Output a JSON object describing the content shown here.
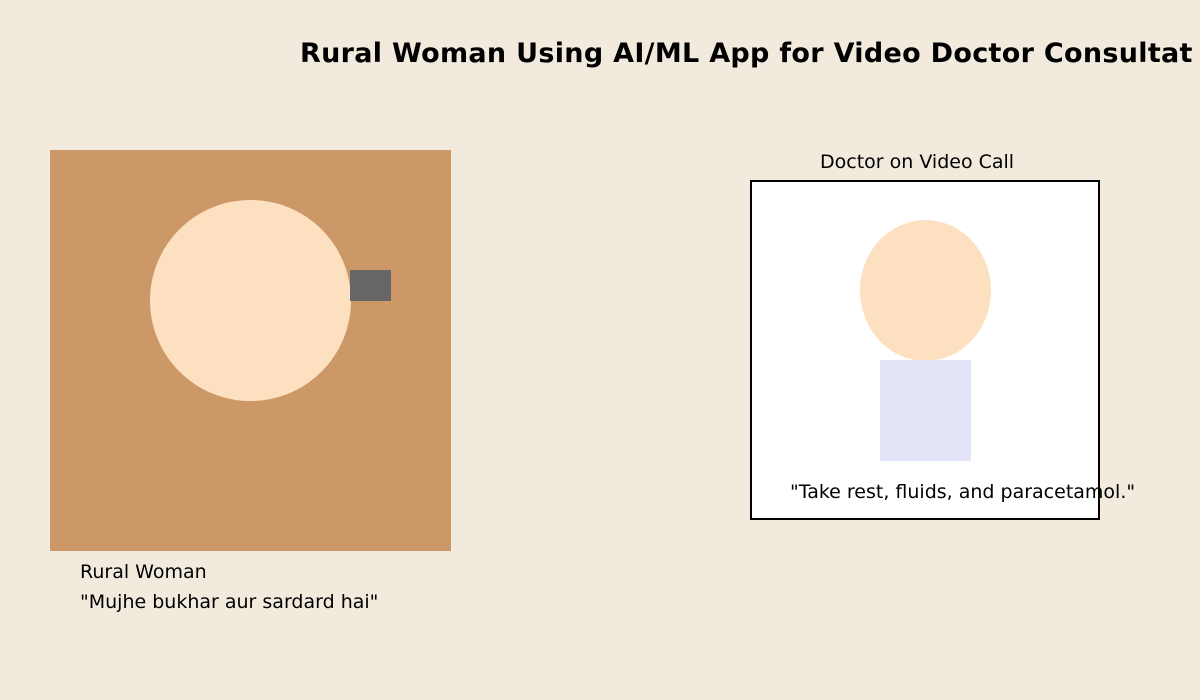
{
  "title": "Rural Woman Using AI/ML App for Video Doctor Consultat",
  "woman": {
    "label": "Rural Woman",
    "speech": "\"Mujhe bukhar aur sardard hai\""
  },
  "doctor": {
    "label": "Doctor on Video Call",
    "speech": "\"Take rest, fluids, and paracetamol.\""
  },
  "colors": {
    "background": "#f1eadd",
    "woman_panel": "#cd9867",
    "skin": "#fde0bf",
    "phone": "#666666",
    "doctor_coat": "#e4e4f8",
    "video_frame": "#ffffff"
  }
}
